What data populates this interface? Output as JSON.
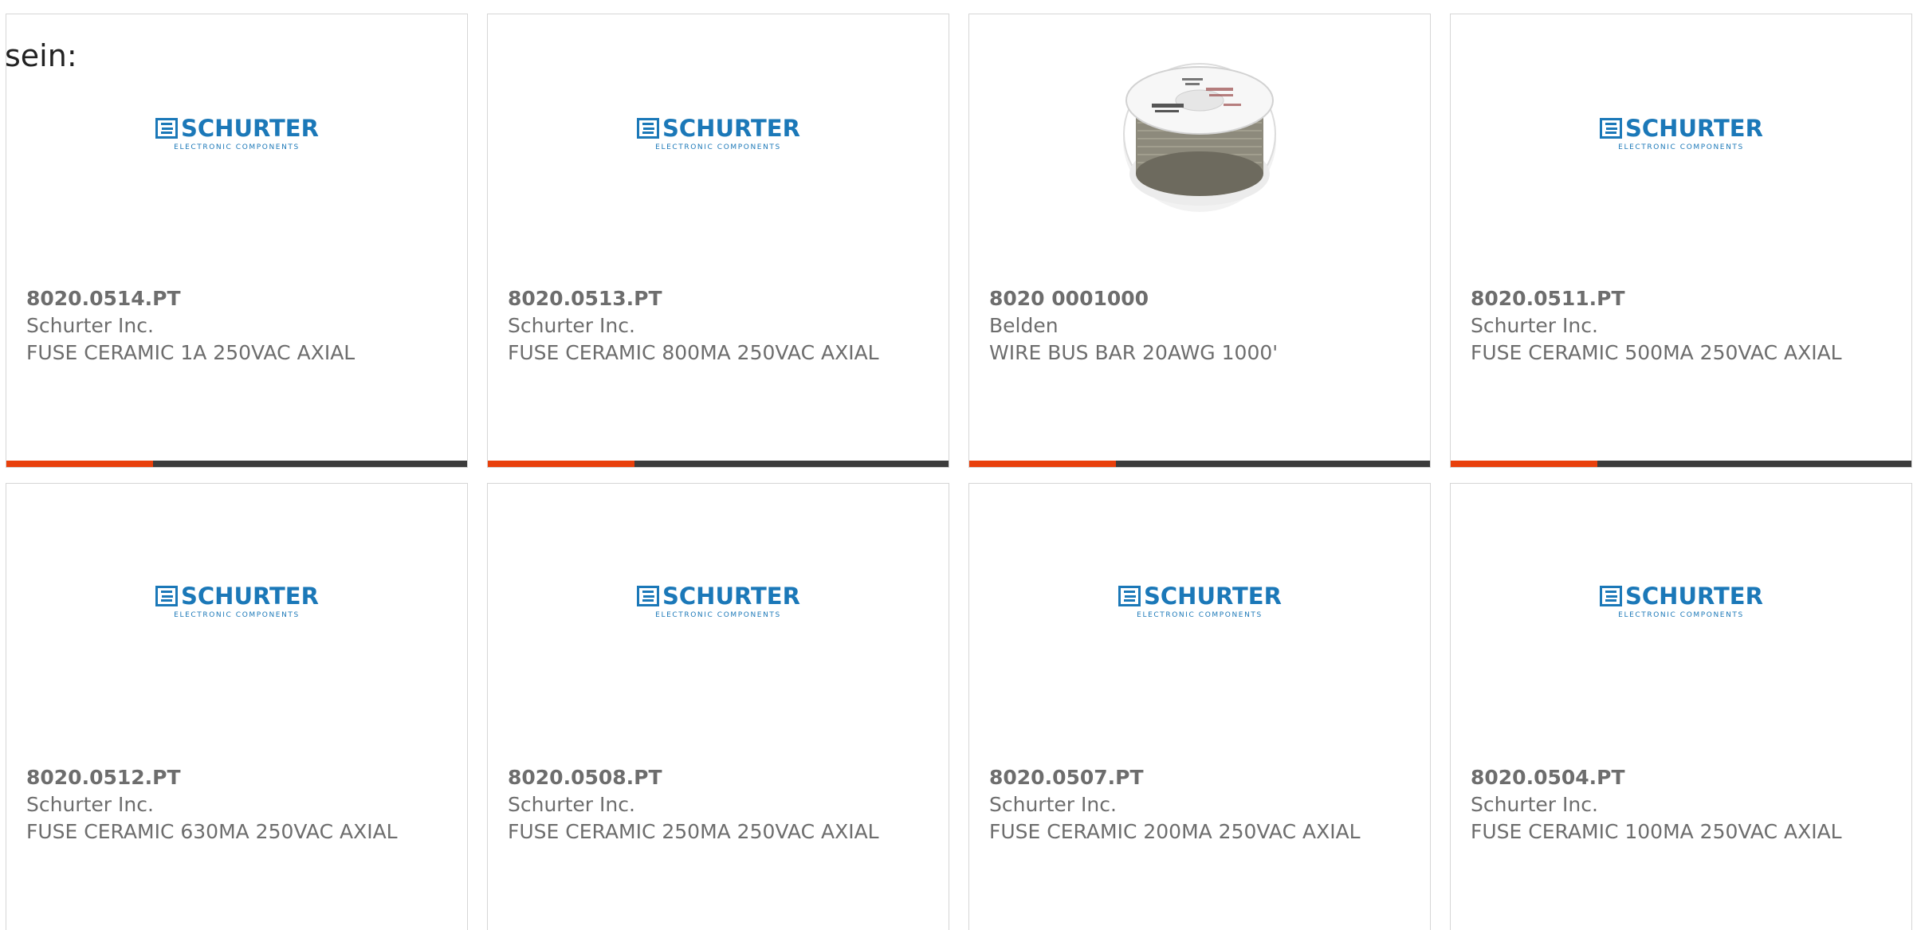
{
  "prefix_text": "sein:",
  "colors": {
    "accent": "#e8400c",
    "bar": "#3c3c3c",
    "text": "#6d6d6d",
    "logo_blue": "#1b78b8",
    "border": "#d6d6d6"
  },
  "logo": {
    "word": "SCHURTER",
    "sub": "ELECTRONIC COMPONENTS"
  },
  "products": [
    {
      "part": "8020.0514.PT",
      "manufacturer": "Schurter Inc.",
      "description": "FUSE CERAMIC 1A 250VAC AXIAL",
      "image": "schurter-logo"
    },
    {
      "part": "8020.0513.PT",
      "manufacturer": "Schurter Inc.",
      "description": "FUSE CERAMIC 800MA 250VAC AXIAL",
      "image": "schurter-logo"
    },
    {
      "part": "8020 0001000",
      "manufacturer": "Belden",
      "description": "WIRE BUS BAR 20AWG 1000'",
      "image": "wire-spool"
    },
    {
      "part": "8020.0511.PT",
      "manufacturer": "Schurter Inc.",
      "description": "FUSE CERAMIC 500MA 250VAC AXIAL",
      "image": "schurter-logo"
    },
    {
      "part": "8020.0512.PT",
      "manufacturer": "Schurter Inc.",
      "description": "FUSE CERAMIC 630MA 250VAC AXIAL",
      "image": "schurter-logo"
    },
    {
      "part": "8020.0508.PT",
      "manufacturer": "Schurter Inc.",
      "description": "FUSE CERAMIC 250MA 250VAC AXIAL",
      "image": "schurter-logo"
    },
    {
      "part": "8020.0507.PT",
      "manufacturer": "Schurter Inc.",
      "description": "FUSE CERAMIC 200MA 250VAC AXIAL",
      "image": "schurter-logo"
    },
    {
      "part": "8020.0504.PT",
      "manufacturer": "Schurter Inc.",
      "description": "FUSE CERAMIC 100MA 250VAC AXIAL",
      "image": "schurter-logo"
    }
  ]
}
